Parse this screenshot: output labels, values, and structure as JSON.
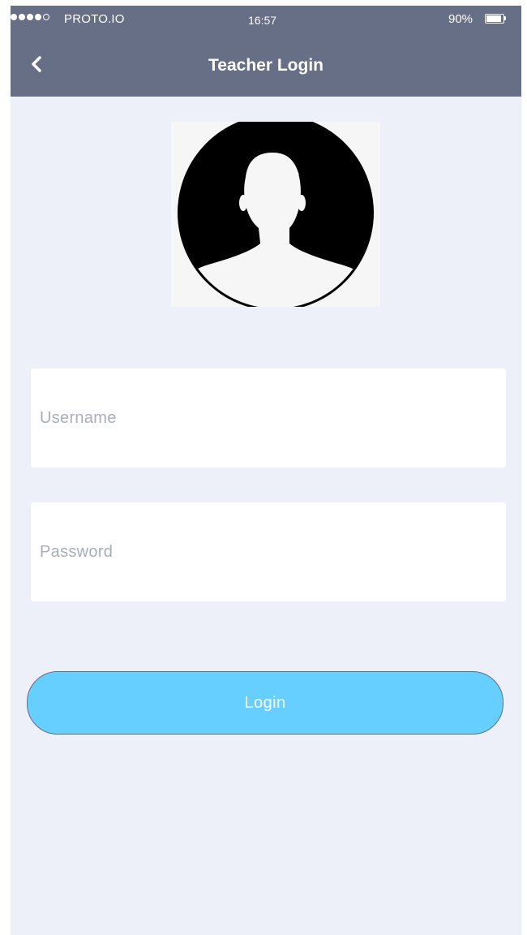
{
  "status_bar": {
    "carrier": "PROTO.IO",
    "time": "16:57",
    "battery_percent": "90%",
    "battery_level": 0.9,
    "signal_bars_filled": 4,
    "signal_bars_total": 5
  },
  "nav": {
    "back_icon": "chevron-left-icon",
    "title": "Teacher Login"
  },
  "avatar": {
    "icon": "user-silhouette-icon"
  },
  "form": {
    "username_placeholder": "Username",
    "username_value": "",
    "password_placeholder": "Password",
    "password_value": "",
    "login_label": "Login"
  },
  "colors": {
    "header": "#676f86",
    "background": "#edf0f8",
    "button": "#66cfff",
    "placeholder": "#a7adbb"
  }
}
